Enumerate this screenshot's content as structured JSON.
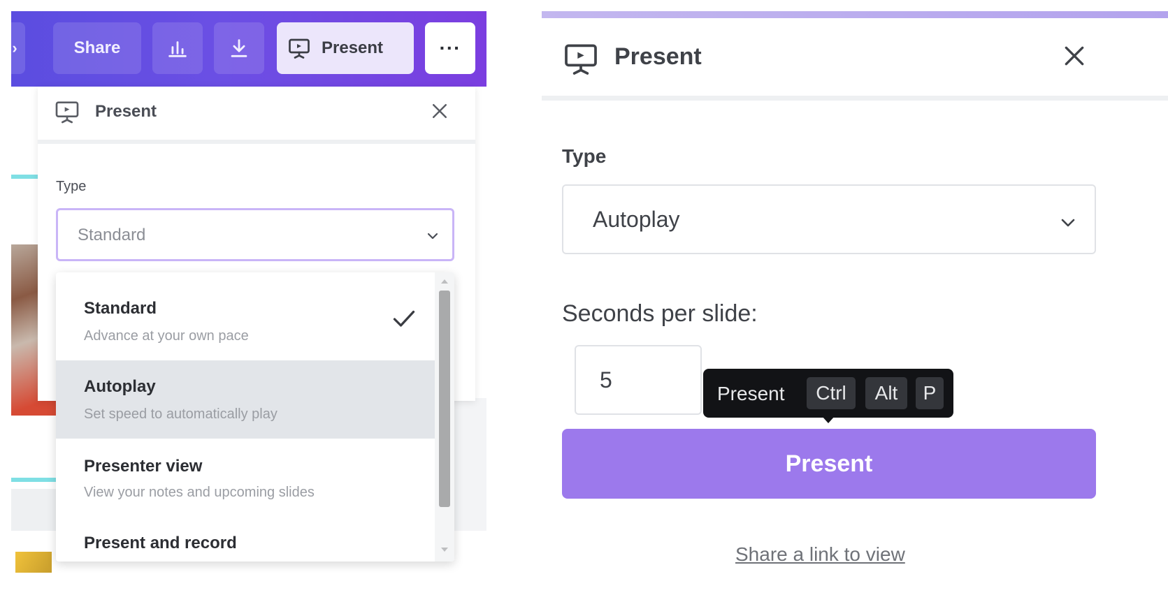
{
  "colors": {
    "accent": "#8b3dff",
    "present_button": "#9c79ec",
    "select_border_focused": "#c9b5f7",
    "highlight_row": "#e2e5e9",
    "tooltip_bg": "#121316"
  },
  "left": {
    "toolbar": {
      "share_label": "Share",
      "insights_icon": "bar-chart-icon",
      "download_icon": "download-icon",
      "present_label": "Present",
      "present_icon": "presentation-screen-icon",
      "more_label": "···"
    },
    "panel": {
      "title": "Present",
      "type_label": "Type",
      "type_value": "Standard"
    },
    "dropdown": {
      "options": [
        {
          "title": "Standard",
          "subtitle": "Advance at your own pace",
          "selected": true
        },
        {
          "title": "Autoplay",
          "subtitle": "Set speed to automatically play",
          "selected": false
        },
        {
          "title": "Presenter view",
          "subtitle": "View your notes and upcoming slides",
          "selected": false
        },
        {
          "title": "Present and record",
          "subtitle": "",
          "selected": false
        }
      ]
    }
  },
  "right": {
    "title": "Present",
    "type_label": "Type",
    "type_value": "Autoplay",
    "seconds_label": "Seconds per slide:",
    "seconds_value": "5",
    "tooltip": {
      "label": "Present",
      "keys": [
        "Ctrl",
        "Alt",
        "P"
      ]
    },
    "present_button": "Present",
    "share_link": "Share a link to view"
  }
}
